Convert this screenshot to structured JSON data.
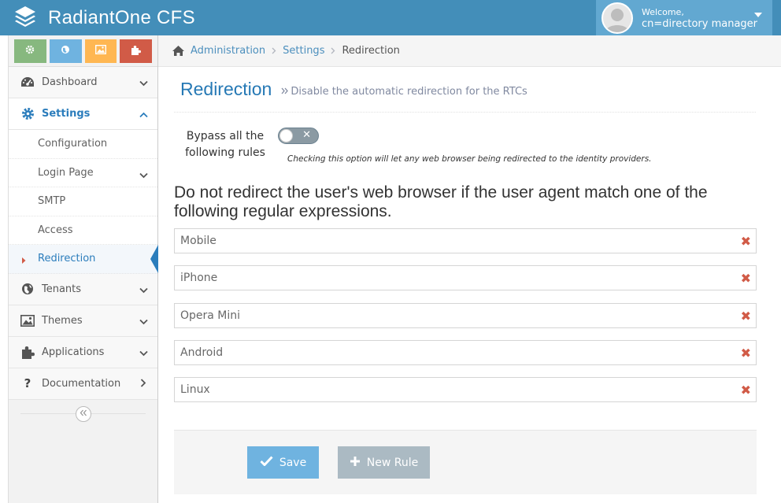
{
  "app": {
    "title": "RadiantOne CFS",
    "welcome": "Welcome,",
    "user": "cn=directory manager"
  },
  "colors": {
    "navbar": "#438eb9",
    "accent": "#2b7dbc",
    "shortcut_green": "#87b87f",
    "shortcut_blue": "#6fb3e0",
    "shortcut_orange": "#ffb752",
    "shortcut_red": "#d15b47"
  },
  "shortcuts": [
    {
      "icon": "gear-icon"
    },
    {
      "icon": "globe-icon"
    },
    {
      "icon": "picture-icon"
    },
    {
      "icon": "puzzle-icon"
    }
  ],
  "sidebar": {
    "items": [
      {
        "label": "Dashboard",
        "icon": "dashboard-icon"
      },
      {
        "label": "Settings",
        "icon": "gear-icon"
      },
      {
        "label": "Tenants",
        "icon": "globe-icon"
      },
      {
        "label": "Themes",
        "icon": "picture-icon"
      },
      {
        "label": "Applications",
        "icon": "puzzle-icon"
      },
      {
        "label": "Documentation",
        "icon": "question-icon"
      }
    ],
    "settings_sub": [
      {
        "label": "Configuration"
      },
      {
        "label": "Login Page"
      },
      {
        "label": "SMTP"
      },
      {
        "label": "Access"
      },
      {
        "label": "Redirection"
      }
    ]
  },
  "breadcrumb": {
    "home": "Administration",
    "parent": "Settings",
    "current": "Redirection"
  },
  "page": {
    "title": "Redirection",
    "subtitle": "Disable the automatic redirection for the RTCs",
    "bypass_label": "Bypass all the following rules",
    "bypass_enabled": false,
    "bypass_help": "Checking this option will let any web browser being redirected to the identity providers.",
    "rules_heading": "Do not redirect the user's web browser if the user agent match one of the following regular expressions.",
    "rules": [
      {
        "value": "Mobile"
      },
      {
        "value": "iPhone"
      },
      {
        "value": "Opera Mini"
      },
      {
        "value": "Android"
      },
      {
        "value": "Linux"
      }
    ],
    "save_label": "Save",
    "new_rule_label": "New Rule"
  }
}
